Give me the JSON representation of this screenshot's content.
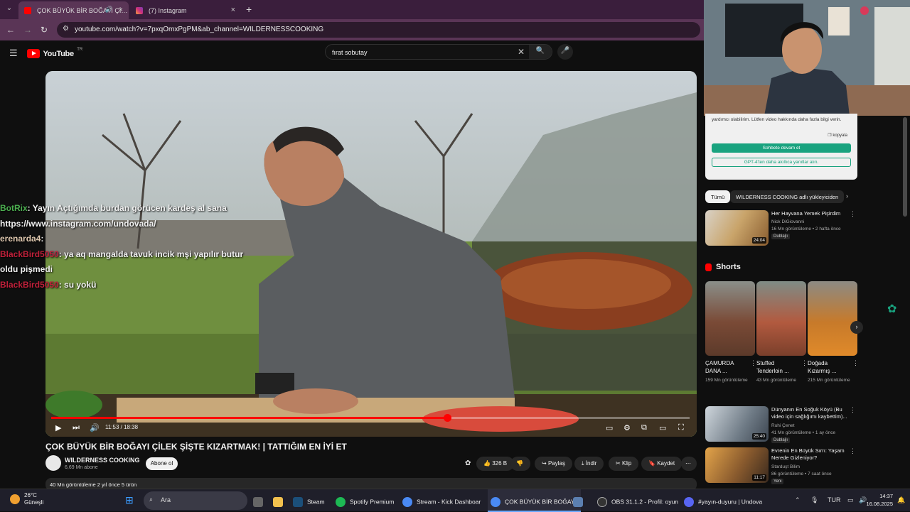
{
  "browser": {
    "tabs": [
      {
        "label": "ÇOK BÜYÜK BİR BOĞAYI Çİ…",
        "active": true
      },
      {
        "label": "(7) Instagram",
        "active": false
      }
    ],
    "url": "youtube.com/watch?v=7pxqOmxPgPM&ab_channel=WILDERNESSCOOKING"
  },
  "youtube": {
    "logo": "YouTube",
    "country": "TR",
    "search_value": "fırat sobutay"
  },
  "chat_messages": [
    {
      "user": "BotRix",
      "text": ": Yayın Açtığımda burdan görücen kardeş al sana"
    },
    {
      "user": "",
      "text": "https://www.instagram.com/undovada/"
    },
    {
      "user": "erenarda4",
      "text": ": "
    },
    {
      "user": "BlackBird5050",
      "text": ": ya aq mangalda tavuk incik mşi yapılır butur"
    },
    {
      "user": "",
      "text": "oldu pişmedi"
    },
    {
      "user": "BlackBird5050",
      "text": ": su yokü"
    }
  ],
  "player": {
    "time": "11:53 / 18:38",
    "progress": 0.62
  },
  "video": {
    "title": "ÇOK BÜYÜK BİR BOĞAYI ÇİLEK ŞİŞTE KIZARTMAK! | TATTIĞIM EN İYİ ET",
    "channel": "WILDERNESS COOKING",
    "subscribers": "6,69 Mn abone",
    "subscribe_label": "Abone ol",
    "likes": "326 B",
    "share": "Paylaş",
    "download": "İndir",
    "clip": "Klip",
    "save": "Kaydet",
    "description": "40 Mn görüntüleme  2 yıl önce  5 ürün"
  },
  "gpt_panel": {
    "text": "yardımcı olabilirim. Lütfen video hakkında daha fazla bilgi verin.",
    "copy": "kopyala",
    "continue_label": "Sohbete devam et",
    "smart_label": "GPT-4'ten daha akıllıca yanıtlar alın."
  },
  "chips": [
    "Tümü",
    "WILDERNESS COOKING adlı yükleyiciden"
  ],
  "recommendations_top": [
    {
      "title": "Her Hayvana Yemek Pişirdim",
      "channel": "Nick DiGiovanni",
      "meta": "16 Mn görüntüleme • 2 hafta önce",
      "badge": "Dublajlı",
      "duration": "24:04"
    }
  ],
  "shorts": {
    "heading": "Shorts",
    "items": [
      {
        "title": "ÇAMURDA DANA ...",
        "views": "159 Mn görüntüleme"
      },
      {
        "title": "Stuffed Tenderloin ...",
        "views": "43 Mn görüntüleme"
      },
      {
        "title": "Doğada Kızarmış ...",
        "views": "215 Mn görüntüleme"
      }
    ]
  },
  "recommendations_bottom": [
    {
      "title": "Dünyanın En Soğuk Köyü (Bu video için sağlığımı kaybettim)...",
      "channel": "Ruhi Çenet",
      "meta": "41 Mn görüntüleme • 1 ay önce",
      "badge": "Dublajlı",
      "duration": "25:40"
    },
    {
      "title": "Evrenin En Büyük Sırrı: Yaşam Nerede Gizleniyor?",
      "channel": "Starduşt Bilim",
      "meta": "86 görüntüleme • 7 saat önce",
      "badge": "Yeni",
      "duration": "11:17"
    }
  ],
  "taskbar": {
    "weather_temp": "26°C",
    "weather_desc": "Güneşli",
    "search": "Ara",
    "apps": [
      "Steam",
      "Spotify Premium",
      "Stream - Kick Dashboar",
      "ÇOK BÜYÜK BİR BOĞAY!",
      "OBS 31.1.2 - Profil: oyun",
      "#yayın-duyuru | Undova"
    ],
    "lang": "TUR",
    "time": "14:37",
    "date": "16.08.2025"
  }
}
